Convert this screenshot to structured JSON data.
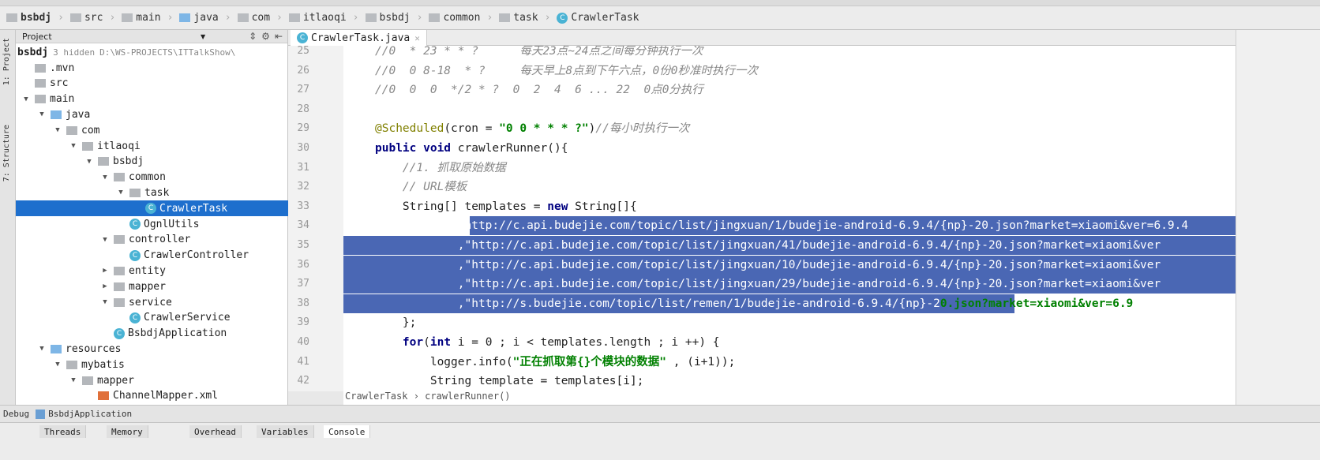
{
  "breadcrumbs": [
    "bsbdj",
    "src",
    "main",
    "java",
    "com",
    "itlaoqi",
    "bsbdj",
    "common",
    "task",
    "CrawlerTask"
  ],
  "project_panel": {
    "title": "Project",
    "root_label": "bsbdj",
    "root_hint": "3 hidden",
    "root_path": "D:\\WS-PROJECTS\\ITTalkShow\\",
    "items": [
      {
        "label": ".mvn",
        "depth": 0,
        "expanded": null
      },
      {
        "label": "src",
        "depth": 0,
        "expanded": null
      },
      {
        "label": "main",
        "depth": 0,
        "expanded": true
      },
      {
        "label": "java",
        "depth": 1,
        "expanded": true
      },
      {
        "label": "com",
        "depth": 2,
        "expanded": true
      },
      {
        "label": "itlaoqi",
        "depth": 3,
        "expanded": true
      },
      {
        "label": "bsbdj",
        "depth": 4,
        "expanded": true
      },
      {
        "label": "common",
        "depth": 5,
        "expanded": true
      },
      {
        "label": "task",
        "depth": 6,
        "expanded": true
      },
      {
        "label": "CrawlerTask",
        "depth": 7,
        "expanded": null,
        "selected": true,
        "class": true
      },
      {
        "label": "OgnlUtils",
        "depth": 6,
        "expanded": null,
        "class": true
      },
      {
        "label": "controller",
        "depth": 5,
        "expanded": true
      },
      {
        "label": "CrawlerController",
        "depth": 6,
        "expanded": null,
        "class": true
      },
      {
        "label": "entity",
        "depth": 5,
        "expanded": false
      },
      {
        "label": "mapper",
        "depth": 5,
        "expanded": false
      },
      {
        "label": "service",
        "depth": 5,
        "expanded": true
      },
      {
        "label": "CrawlerService",
        "depth": 6,
        "expanded": null,
        "class": true
      },
      {
        "label": "BsbdjApplication",
        "depth": 5,
        "expanded": null,
        "class": true
      },
      {
        "label": "resources",
        "depth": 1,
        "expanded": true
      },
      {
        "label": "mybatis",
        "depth": 2,
        "expanded": true
      },
      {
        "label": "mapper",
        "depth": 3,
        "expanded": true
      },
      {
        "label": "ChannelMapper.xml",
        "depth": 4,
        "expanded": null,
        "xml": true
      }
    ]
  },
  "side_labels": {
    "project": "1: Project",
    "structure": "7: Structure"
  },
  "editor": {
    "tab": "CrawlerTask.java",
    "lines": [
      {
        "n": "25",
        "html": "<span class='cm'>//0  * 23 * * ?      每天23点~24点之间每分钟执行一次</span>"
      },
      {
        "n": "26",
        "html": "<span class='cm'>//0  0 8-18  * ?     每天早上8点到下午六点，0份0秒准时执行一次</span>"
      },
      {
        "n": "27",
        "html": "<span class='cm'>//0  0  0  */2 * ?  0  2  4  6 ... 22  0点0分执行</span>"
      },
      {
        "n": "28",
        "html": ""
      },
      {
        "n": "29",
        "html": "<span class='an'>@Scheduled</span>(cron = <span class='st'>\"0 0 * * * ?\"</span>)<span class='cm'>//每小时执行一次</span>"
      },
      {
        "n": "30",
        "html": "<span class='kw'>public void</span> crawlerRunner(){"
      },
      {
        "n": "31",
        "html": "    <span class='cm'>//1. 抓取原始数据</span>"
      },
      {
        "n": "32",
        "html": "    <span class='cm'>// URL模板</span>"
      },
      {
        "n": "33",
        "html": "    String[] templates = <span class='kw'>new</span> String[]{"
      },
      {
        "n": "34",
        "html": "            <span class='sel-txt'>\"http://c.api.budejie.com/topic/list/jingxuan/1/budejie-android-6.9.4/{np}-20.json?market=xiaomi&ver=6.9.4</span>",
        "sel": true
      },
      {
        "n": "35",
        "html": "<span class='sel-txt'>            ,\"http://c.api.budejie.com/topic/list/jingxuan/41/budejie-android-6.9.4/{np}-20.json?market=xiaomi&ver</span>",
        "sel": true
      },
      {
        "n": "36",
        "html": "<span class='sel-txt'>            ,\"http://c.api.budejie.com/topic/list/jingxuan/10/budejie-android-6.9.4/{np}-20.json?market=xiaomi&ver</span>",
        "sel": true
      },
      {
        "n": "37",
        "html": "<span class='sel-txt'>            ,\"http://c.api.budejie.com/topic/list/jingxuan/29/budejie-android-6.9.4/{np}-20.json?market=xiaomi&ver</span>",
        "sel": true
      },
      {
        "n": "38",
        "html": "<span class='sel-txt'>            ,\"http://s.budejie.com/topic/list/remen/1/budejie-android-6.9.4/{np}-2</span><span class='st'>0.json?market=xiaomi&ver=6.9</span>",
        "sel": "partial"
      },
      {
        "n": "39",
        "html": "    };"
      },
      {
        "n": "40",
        "html": "    <span class='kw'>for</span>(<span class='kw'>int</span> i = 0 ; i &lt; templates.length ; i ++) {"
      },
      {
        "n": "41",
        "html": "        logger.info(<span class='st'>\"正在抓取第{}个模块的数据\"</span> , (i+1));"
      },
      {
        "n": "42",
        "html": "        String template = templates[i];"
      }
    ],
    "breadcrumb": "CrawlerTask › crawlerRunner()"
  },
  "debug": {
    "label": "Debug",
    "config": "BsbdjApplication",
    "tabs": [
      "Threads",
      "Memory",
      "Overhead",
      "Variables",
      "Console"
    ],
    "active_tab": "Console"
  },
  "colors": {
    "selection": "#4a67b4",
    "tree_selection": "#1e6fcd",
    "string": "#008000",
    "keyword": "#000080"
  }
}
